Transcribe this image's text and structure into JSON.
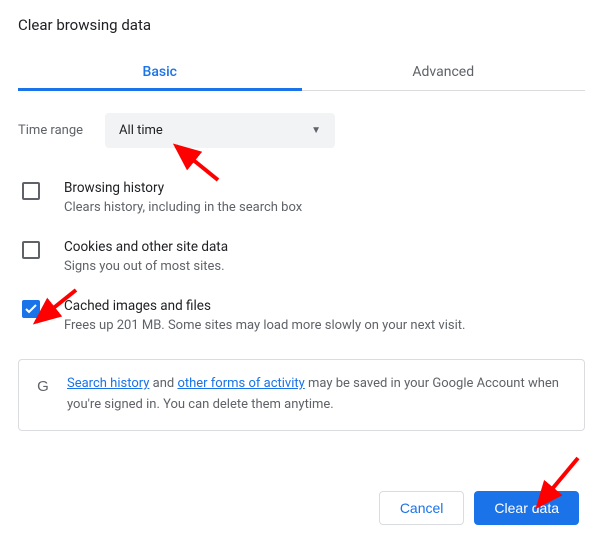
{
  "dialog": {
    "title": "Clear browsing data",
    "tabs": {
      "basic": "Basic",
      "advanced": "Advanced"
    }
  },
  "timerange": {
    "label": "Time range",
    "selected": "All time"
  },
  "options": {
    "history": {
      "title": "Browsing history",
      "sub": "Clears history, including in the search box"
    },
    "cookies": {
      "title": "Cookies and other site data",
      "sub": "Signs you out of most sites."
    },
    "cache": {
      "title": "Cached images and files",
      "sub": "Frees up 201 MB. Some sites may load more slowly on your next visit."
    }
  },
  "info": {
    "link1": "Search history",
    "mid": " and ",
    "link2": "other forms of activity",
    "rest": " may be saved in your Google Account when you're signed in. You can delete them anytime."
  },
  "buttons": {
    "cancel": "Cancel",
    "clear": "Clear data"
  },
  "colors": {
    "accent": "#1a73e8",
    "arrow": "#ff0000"
  }
}
